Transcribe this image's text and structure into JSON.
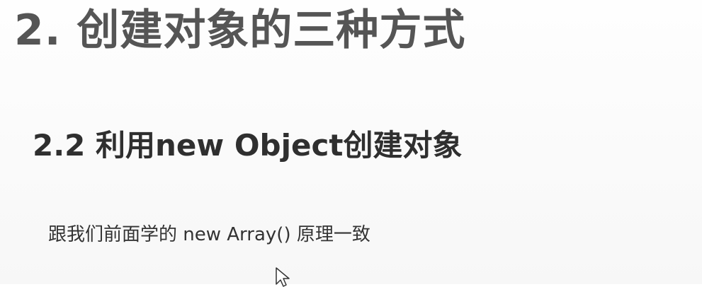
{
  "slide": {
    "title": "2. 创建对象的三种方式",
    "subtitle": "2.2 利用new Object创建对象",
    "body": "跟我们前面学的 new Array() 原理一致"
  },
  "icons": {
    "cursor": "mouse-pointer-icon"
  }
}
